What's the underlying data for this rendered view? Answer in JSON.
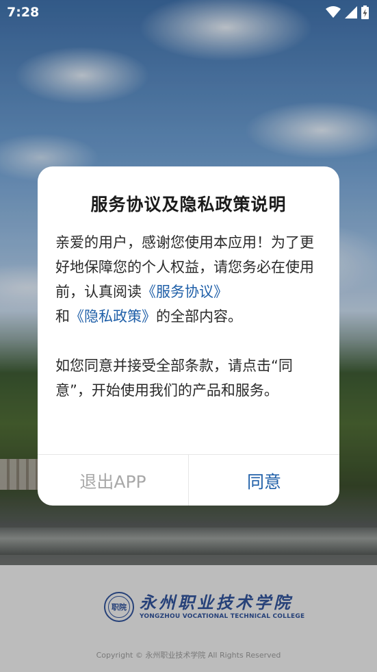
{
  "status_bar": {
    "time": "7:28",
    "icons": [
      "wifi-icon",
      "signal-icon",
      "battery-charging-icon"
    ]
  },
  "dialog": {
    "title": "服务协议及隐私政策说明",
    "p1_intro": "亲爱的用户，感谢您使用本应用！为了更好地保障您的个人权益，请您务必在使用前，认真阅读",
    "link_service": "《服务协议》",
    "p1_and": "和",
    "link_privacy": "《隐私政策》",
    "p1_tail": "的全部内容。",
    "p2": "如您同意并接受全部条款，请点击“同意”，开始使用我们的产品和服务。",
    "exit_button": "退出APP",
    "agree_button": "同意",
    "colors": {
      "link": "#1f5fa8",
      "exit": "#a8a8a8",
      "agree": "#1f5fa8"
    }
  },
  "splash": {
    "school_name_cn": "永州职业技术学院",
    "school_name_en": "YONGZHOU VOCATIONAL TECHNICAL COLLEGE",
    "seal_text": "职院",
    "copyright": "Copyright © 永州职业技术学院 All Rights Reserved"
  }
}
